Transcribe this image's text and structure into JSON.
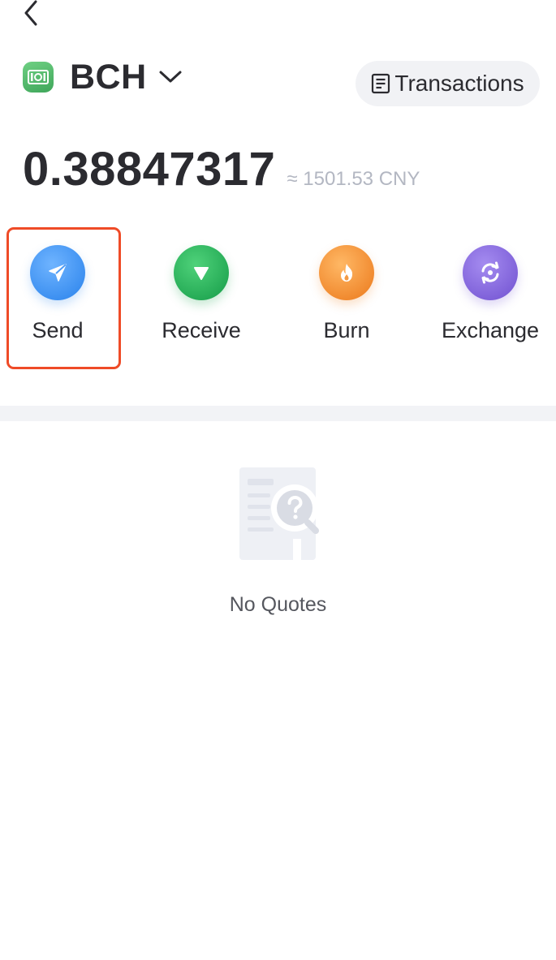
{
  "nav": {
    "back_icon": "chevron-left-icon"
  },
  "header": {
    "coin_symbol": "BCH",
    "coin_icon": "bch-coin-icon",
    "dropdown_icon": "chevron-down-icon",
    "transactions_label": "Transactions",
    "transactions_icon": "document-list-icon"
  },
  "balance": {
    "amount": "0.38847317",
    "fiat": "≈ 1501.53 CNY"
  },
  "actions": [
    {
      "label": "Send",
      "icon": "paper-plane-icon",
      "color": "#3a8ef0"
    },
    {
      "label": "Receive",
      "icon": "arrow-down-icon",
      "color": "#23a954"
    },
    {
      "label": "Burn",
      "icon": "flame-icon",
      "color": "#f0882d"
    },
    {
      "label": "Exchange",
      "icon": "refresh-icon",
      "color": "#7d5fd8"
    }
  ],
  "highlight_color": "#ef4b27",
  "quotes": {
    "empty_icon": "no-results-document-icon",
    "empty_text": "No Quotes"
  }
}
